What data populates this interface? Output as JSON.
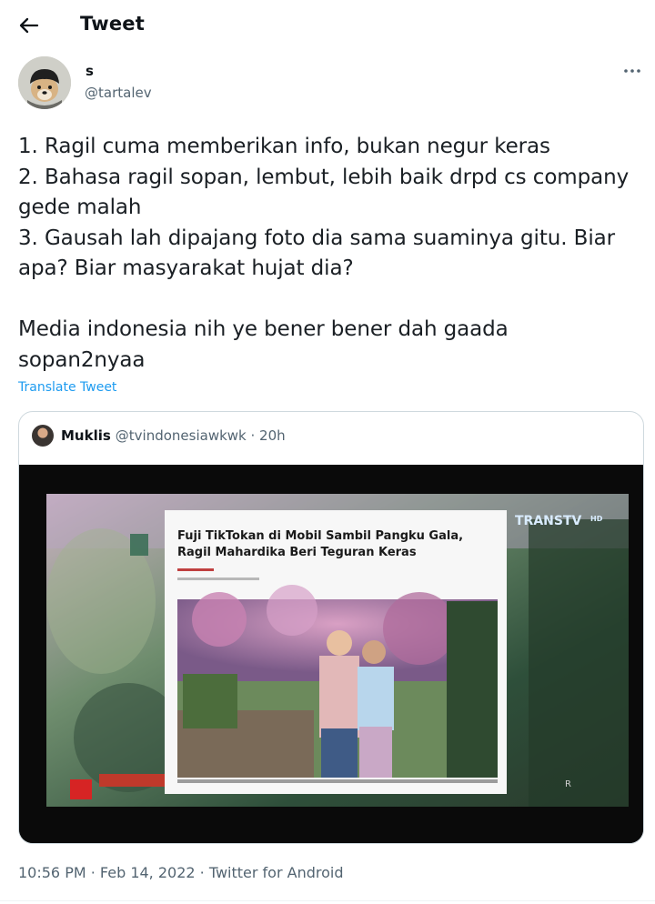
{
  "header": {
    "title": "Tweet",
    "back_icon": "arrow-left-icon"
  },
  "author": {
    "display_name": "s",
    "handle": "@tartalev"
  },
  "tweet": {
    "text": "1. Ragil cuma memberikan info, bukan negur keras\n2. Bahasa ragil sopan, lembut, lebih baik drpd cs company gede malah\n3. Gausah lah dipajang foto dia sama suaminya gitu. Biar apa? Biar masyarakat hujat dia?\n\nMedia indonesia nih ye bener bener dah gaada sopan2nyaa",
    "translate_label": "Translate Tweet",
    "timestamp": "10:56 PM · Feb 14, 2022 · Twitter for Android"
  },
  "quote": {
    "display_name": "Muklis",
    "meta": "@tvindonesiawkwk · 20h",
    "media": {
      "channel_logo": "TRANSTV",
      "channel_suffix": "HD",
      "headline_line1": "Fuji TikTokan di Mobil Sambil Pangku Gala,",
      "headline_line2": "Ragil Mahardika Beri Teguran Keras"
    }
  },
  "colors": {
    "link": "#1d9bf0",
    "muted": "#536471",
    "border": "#cfd9de",
    "text": "#0f1419"
  }
}
